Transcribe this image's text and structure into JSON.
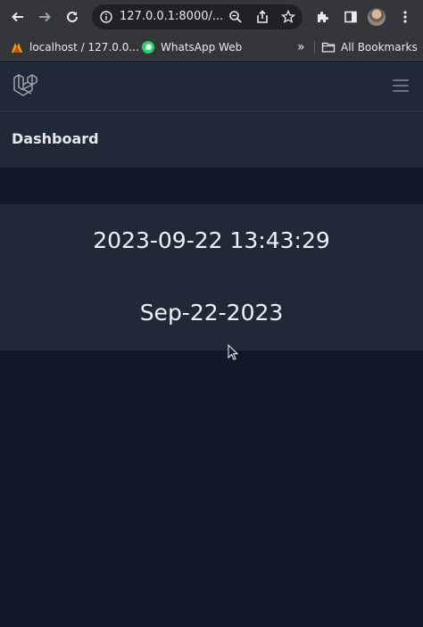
{
  "browser": {
    "url": "127.0.0.1:8000/...",
    "bookmarks": [
      {
        "label": "localhost / 127.0.0...",
        "icon": "phpmyadmin-icon"
      },
      {
        "label": "WhatsApp Web",
        "icon": "whatsapp-icon"
      }
    ],
    "overflow_label": "»",
    "all_bookmarks_label": "All Bookmarks"
  },
  "app": {
    "page_title": "Dashboard",
    "datetime": "2023-09-22 13:43:29",
    "date": "Sep-22-2023"
  },
  "colors": {
    "background": "#111827",
    "surface": "#1f2937",
    "browser_chrome": "#35363a"
  }
}
